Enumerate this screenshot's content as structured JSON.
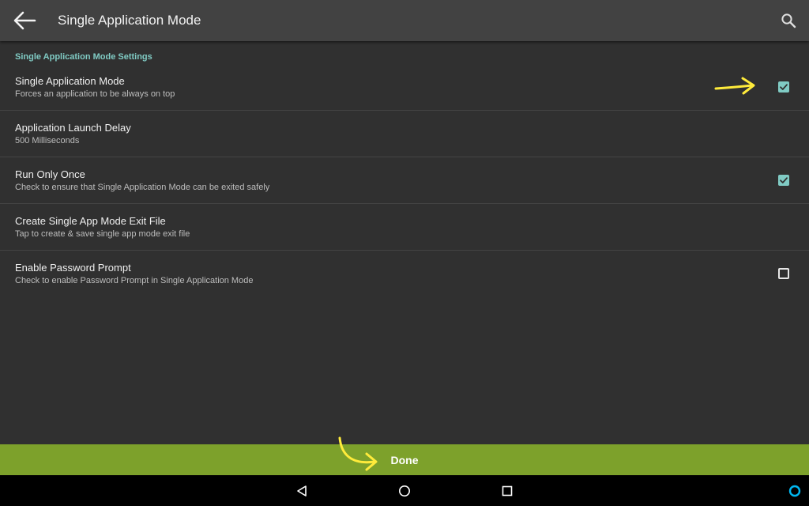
{
  "appbar": {
    "title": "Single Application Mode",
    "back_icon": "arrow-back-icon",
    "search_icon": "search-icon"
  },
  "settings": {
    "section_header": "Single Application Mode Settings",
    "items": [
      {
        "title": "Single Application Mode",
        "summary": "Forces an application to be always on top",
        "checkbox": true,
        "checked": true
      },
      {
        "title": "Application Launch Delay",
        "summary": "500 Milliseconds",
        "checkbox": false
      },
      {
        "title": "Run Only Once",
        "summary": "Check to ensure that Single Application Mode can be exited safely",
        "checkbox": true,
        "checked": true
      },
      {
        "title": "Create Single App Mode Exit File",
        "summary": "Tap to create & save single app mode exit file",
        "checkbox": false
      },
      {
        "title": "Enable Password Prompt",
        "summary": "Check to enable Password Prompt in Single Application Mode",
        "checkbox": true,
        "checked": false
      }
    ]
  },
  "done_button": {
    "label": "Done"
  },
  "navbar": {
    "icons": [
      "back-triangle-icon",
      "home-circle-icon",
      "recents-square-icon",
      "assistant-ring-icon"
    ]
  },
  "colors": {
    "background": "#303030",
    "appbar": "#424242",
    "accent": "#80cbc4",
    "done_bar": "#7da12b",
    "annotation_arrow": "#ffeb3b"
  }
}
